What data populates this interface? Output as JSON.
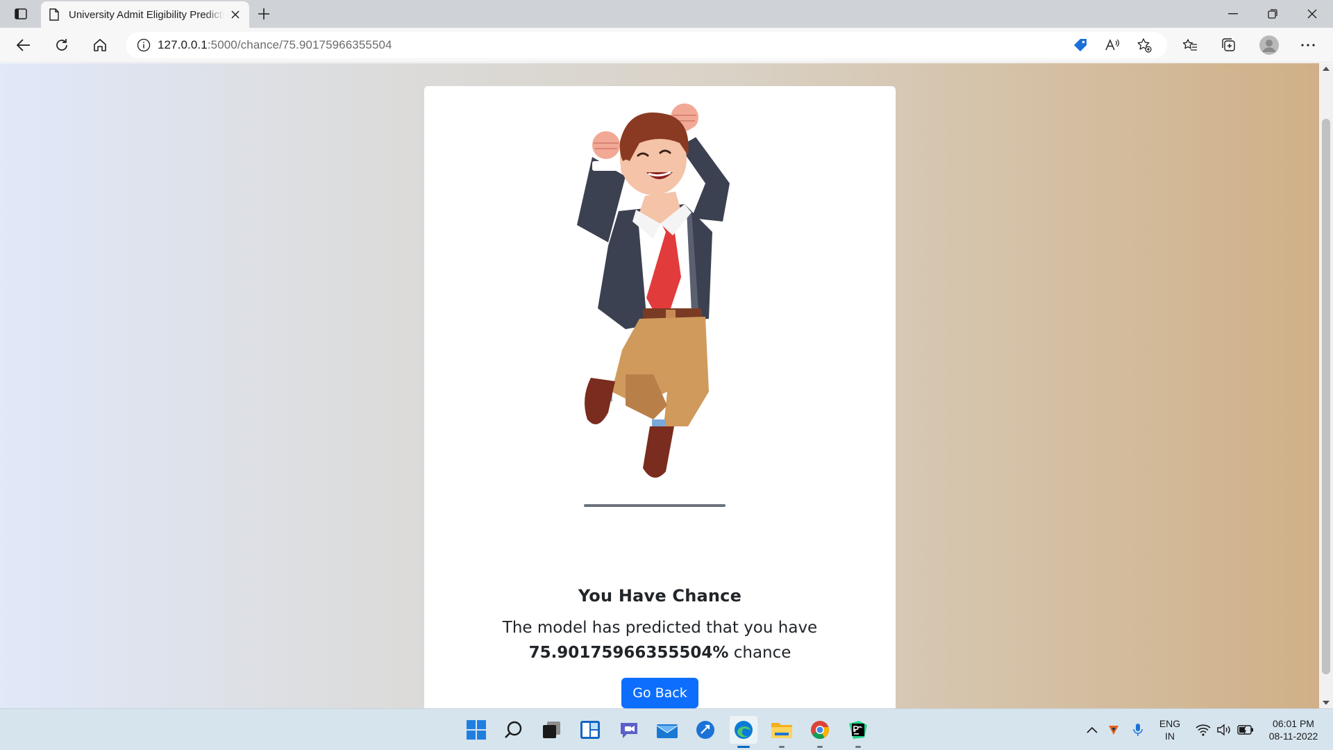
{
  "browser": {
    "tab_title": "University Admit Eligibility Prediction",
    "url_host": "127.0.0.1",
    "url_rest": ":5000/chance/75.90175966355504",
    "icons": [
      "tab-actions-icon",
      "page-icon",
      "close-icon",
      "new-tab-icon",
      "minimize-icon",
      "restore-icon",
      "window-close-icon",
      "back-icon",
      "refresh-icon",
      "home-icon",
      "info-icon",
      "shopping-tag-icon",
      "read-aloud-icon",
      "add-favorite-icon",
      "favorites-icon",
      "collections-icon",
      "profile-icon",
      "more-icon"
    ]
  },
  "page": {
    "title": "You Have Chance",
    "text_before": "The model has predicted that you have",
    "chance_value": "75.90175966355504%",
    "text_after": "chance",
    "button_label": "Go Back",
    "colors": {
      "button": "#0d6efd",
      "gradient_left": "#e0e8f9",
      "gradient_right": "#d0b087"
    }
  },
  "taskbar": {
    "apps": [
      "start-icon",
      "search-icon",
      "task-view-icon",
      "widgets-icon",
      "teams-chat-icon",
      "mail-icon",
      "feedback-icon",
      "edge-icon",
      "file-explorer-icon",
      "chrome-icon",
      "pycharm-icon"
    ],
    "lang_line1": "ENG",
    "lang_line2": "IN",
    "time": "06:01 PM",
    "date": "08-11-2022"
  }
}
